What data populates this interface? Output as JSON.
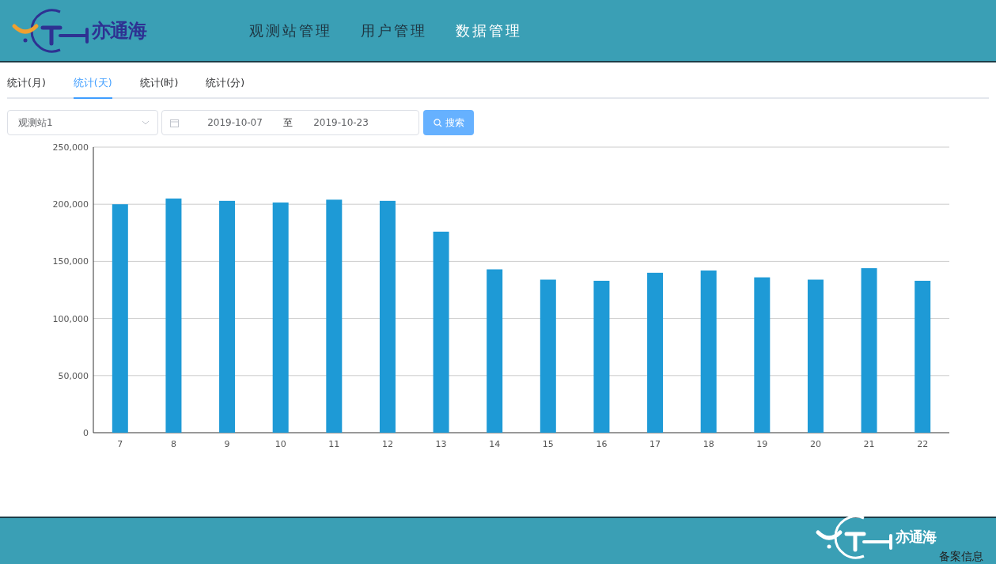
{
  "header": {
    "logo_text": "亦通海",
    "nav": [
      {
        "label": "观测站管理",
        "selected": false
      },
      {
        "label": "用户管理",
        "selected": false
      },
      {
        "label": "数据管理",
        "selected": true
      }
    ]
  },
  "tabs": [
    {
      "label": "统计(月)",
      "selected": false
    },
    {
      "label": "统计(天)",
      "selected": true
    },
    {
      "label": "统计(时)",
      "selected": false
    },
    {
      "label": "统计(分)",
      "selected": false
    }
  ],
  "filters": {
    "station": "观测站1",
    "start_date": "2019-10-07",
    "range_separator": "至",
    "end_date": "2019-10-23",
    "search_button": "搜索"
  },
  "chart_data": {
    "type": "bar",
    "categories": [
      "7",
      "8",
      "9",
      "10",
      "11",
      "12",
      "13",
      "14",
      "15",
      "16",
      "17",
      "18",
      "19",
      "20",
      "21",
      "22"
    ],
    "grid": true,
    "series": [
      {
        "color": "#1e9ad6",
        "values": [
          200000,
          205000,
          203000,
          201500,
          204000,
          203000,
          176000,
          143000,
          134000,
          133000,
          140000,
          142000,
          136000,
          134000,
          144000,
          133000
        ]
      }
    ],
    "ylim": [
      0,
      250000
    ],
    "yticks": [
      {
        "value": 0,
        "label": "0"
      },
      {
        "value": 50000,
        "label": "50,000"
      },
      {
        "value": 100000,
        "label": "100,000"
      },
      {
        "value": 150000,
        "label": "150,000"
      },
      {
        "value": 200000,
        "label": "200,000"
      },
      {
        "value": 250000,
        "label": "250,000"
      }
    ]
  },
  "footer": {
    "logo_text": "亦通海",
    "record_info": "备案信息"
  }
}
